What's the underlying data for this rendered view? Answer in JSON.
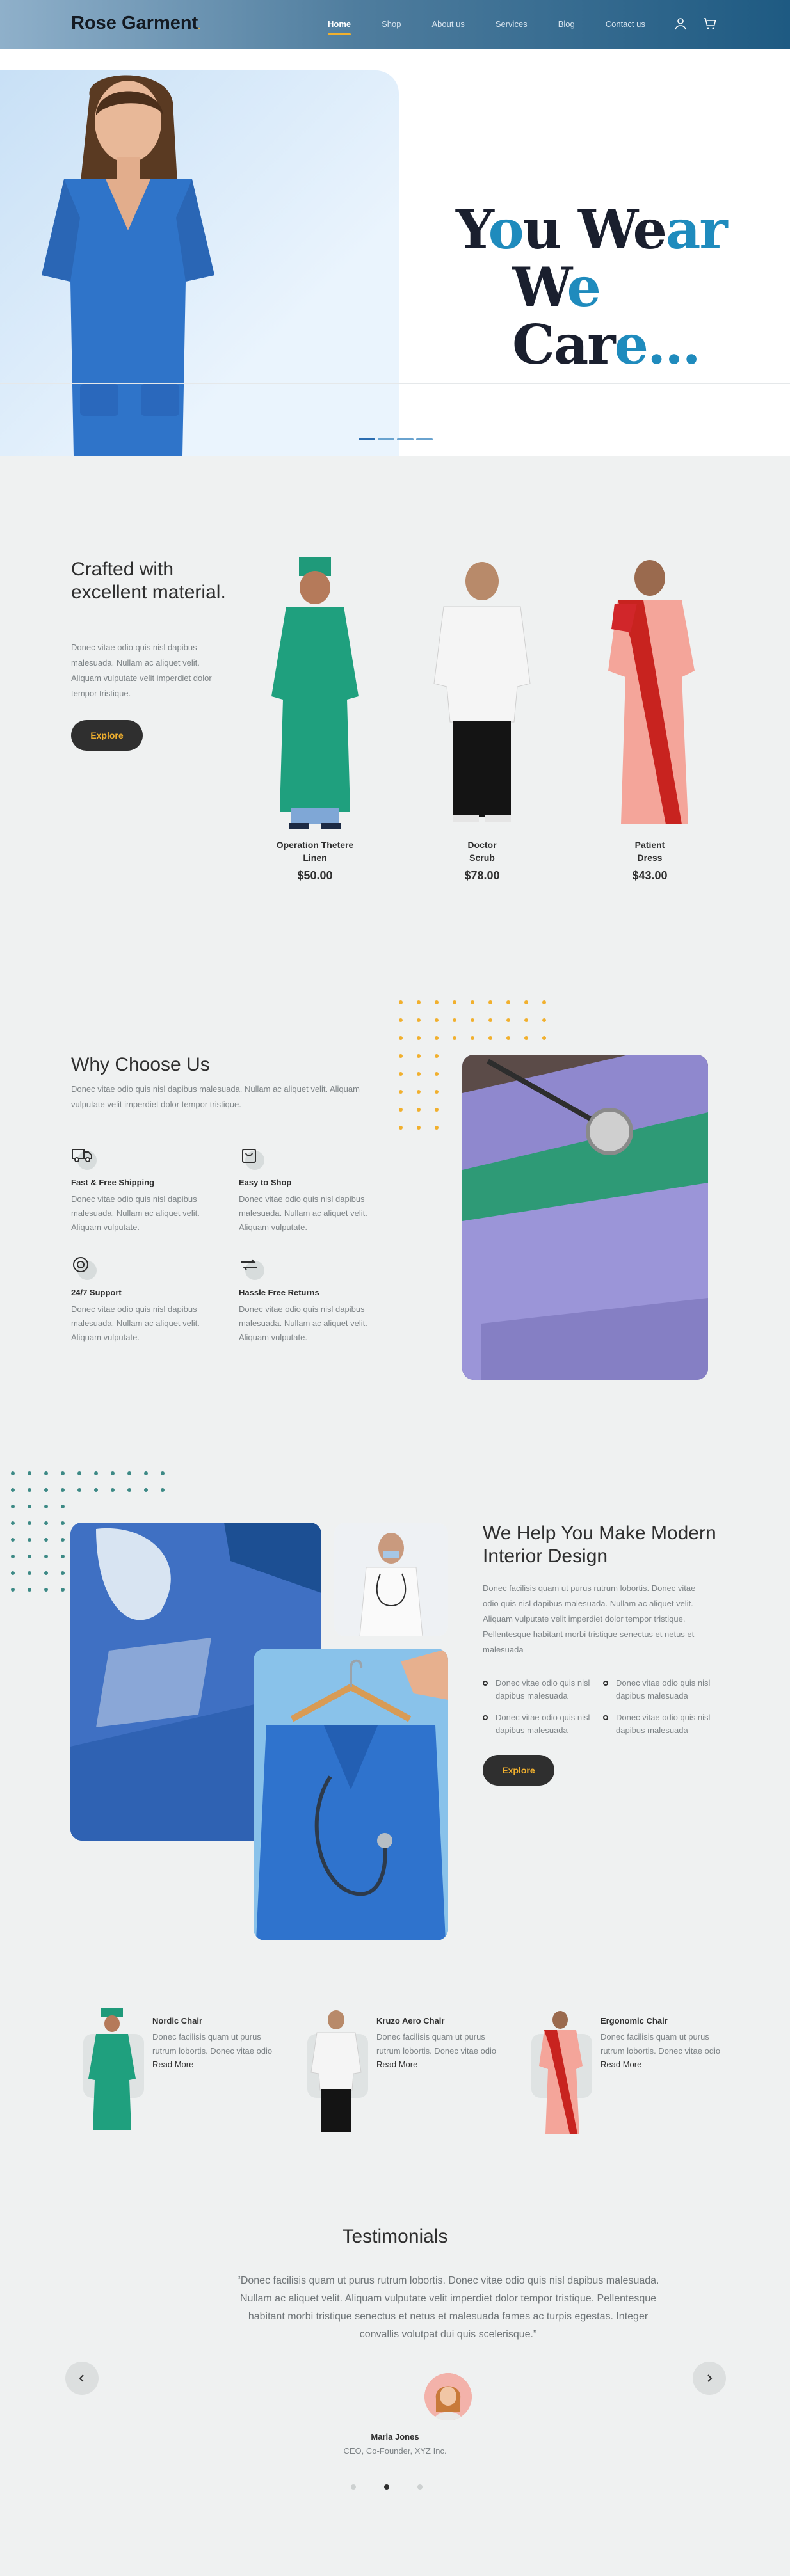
{
  "brand": {
    "name": "Rose Garment",
    "dot": "."
  },
  "nav": {
    "items": [
      "Home",
      "Shop",
      "About us",
      "Services",
      "Blog",
      "Contact us"
    ],
    "icons": [
      "user-icon",
      "cart-icon"
    ]
  },
  "hero": {
    "line1_a": "Y",
    "line1_b": "o",
    "line1_c": "u W",
    "line1_d": "e",
    "line1_e": "ar",
    "line2_a": "W",
    "line2_b": "e",
    "line2_c": " Car",
    "line2_d": "e",
    "line2_e": "..."
  },
  "crafted": {
    "title": "Crafted with excellent material.",
    "text": "Donec vitae odio quis nisl dapibus malesuada. Nullam ac aliquet velit. Aliquam vulputate velit imperdiet dolor tempor tristique.",
    "button": "Explore",
    "products": [
      {
        "name_line1": "Operation Thetere",
        "name_line2": "Linen",
        "price": "$50.00"
      },
      {
        "name_line1": "Doctor",
        "name_line2": "Scrub",
        "price": "$78.00"
      },
      {
        "name_line1": "Patient",
        "name_line2": "Dress",
        "price": "$43.00"
      }
    ]
  },
  "why": {
    "title": "Why Choose Us",
    "text": "Donec vitae odio quis nisl dapibus malesuada. Nullam ac aliquet velit. Aliquam vulputate velit imperdiet dolor tempor tristique.",
    "features": [
      {
        "title": "Fast & Free Shipping",
        "text": "Donec vitae odio quis nisl dapibus malesuada. Nullam ac aliquet velit. Aliquam vulputate.",
        "icon": "truck-icon"
      },
      {
        "title": "Easy to Shop",
        "text": "Donec vitae odio quis nisl dapibus malesuada. Nullam ac aliquet velit. Aliquam vulputate.",
        "icon": "shopping-bag-icon"
      },
      {
        "title": "24/7 Support",
        "text": "Donec vitae odio quis nisl dapibus malesuada. Nullam ac aliquet velit. Aliquam vulputate.",
        "icon": "support-icon"
      },
      {
        "title": "Hassle Free Returns",
        "text": "Donec vitae odio quis nisl dapibus malesuada. Nullam ac aliquet velit. Aliquam vulputate.",
        "icon": "returns-icon"
      }
    ]
  },
  "help": {
    "title": "We Help You Make Modern Interior Design",
    "text": "Donec facilisis quam ut purus rutrum lobortis. Donec vitae odio quis nisl dapibus malesuada. Nullam ac aliquet velit. Aliquam vulputate velit imperdiet dolor tempor tristique. Pellentesque habitant morbi tristique senectus et netus et malesuada",
    "bullets": [
      "Donec vitae odio quis nisl dapibus malesuada",
      "Donec vitae odio quis nisl dapibus malesuada",
      "Donec vitae odio quis nisl dapibus malesuada",
      "Donec vitae odio quis nisl dapibus malesuada"
    ],
    "button": "Explore"
  },
  "small_products": [
    {
      "title": "Nordic Chair",
      "text": "Donec facilisis quam ut purus rutrum lobortis. Donec vitae odio",
      "link": "Read More"
    },
    {
      "title": "Kruzo Aero Chair",
      "text": "Donec facilisis quam ut purus rutrum lobortis. Donec vitae odio",
      "link": "Read More"
    },
    {
      "title": "Ergonomic Chair",
      "text": "Donec facilisis quam ut purus rutrum lobortis. Donec vitae odio",
      "link": "Read More"
    }
  ],
  "testimonials": {
    "title": "Testimonials",
    "quote": "“Donec facilisis quam ut purus rutrum lobortis. Donec vitae odio quis nisl dapibus malesuada. Nullam ac aliquet velit. Aliquam vulputate velit imperdiet dolor tempor tristique. Pellentesque habitant morbi tristique senectus et netus et malesuada fames ac turpis egestas. Integer convallis volutpat dui quis scelerisque.”",
    "name": "Maria Jones",
    "role": "CEO, Co-Founder, XYZ Inc."
  },
  "colors": {
    "accent": "#f1b02e",
    "brand_blue": "#1f8bbd",
    "dark": "#2f2f2f",
    "bg": "#eff1f1"
  }
}
